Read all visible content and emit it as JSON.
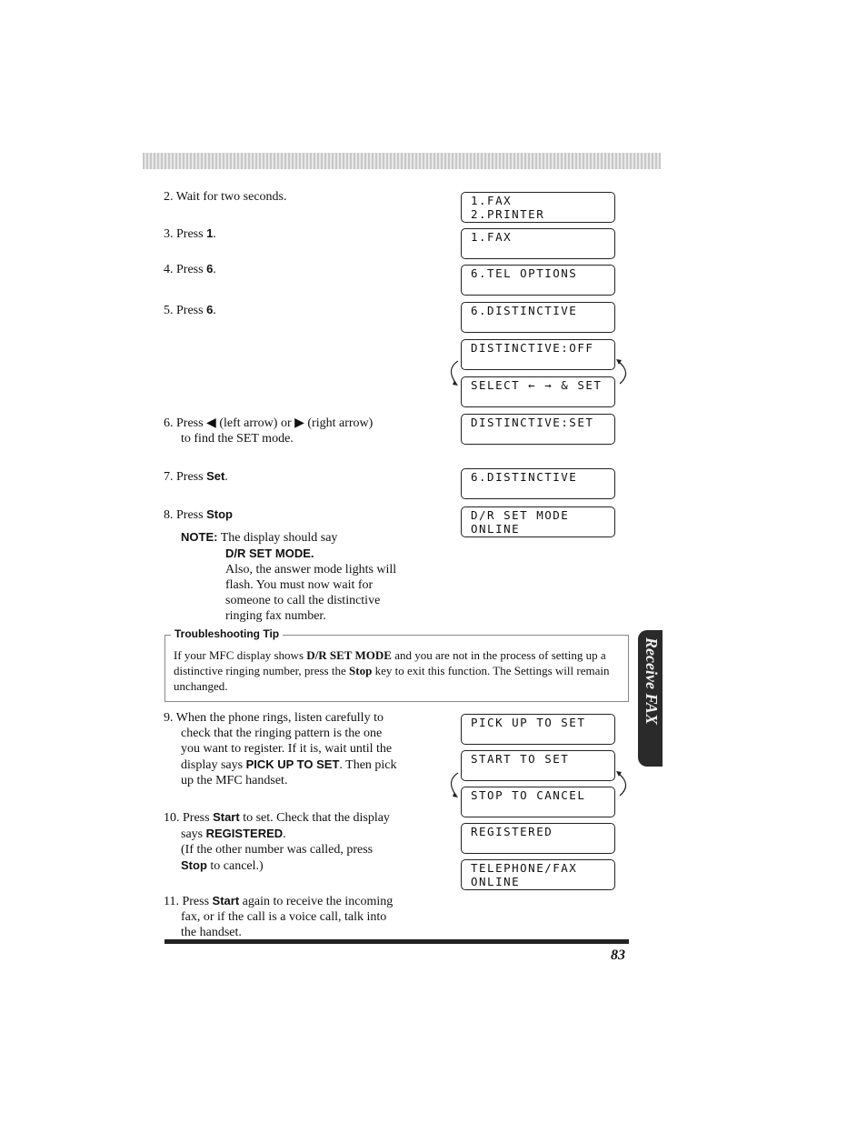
{
  "steps": [
    {
      "num": "2.",
      "text": "Wait for two seconds."
    },
    {
      "num": "3.",
      "pre": "Press ",
      "key": "1",
      "post": "."
    },
    {
      "num": "4.",
      "pre": "Press ",
      "key": "6",
      "post": "."
    },
    {
      "num": "5.",
      "pre": "Press ",
      "key": "6",
      "post": "."
    },
    {
      "num": "6.",
      "line1": "Press ◀ (left arrow) or ▶ (right arrow)",
      "line2": "to find the SET mode."
    },
    {
      "num": "7.",
      "pre": "Press ",
      "key": "Set",
      "post": "."
    },
    {
      "num": "8.",
      "pre": "Press ",
      "key": "Stop",
      "post": ""
    },
    {
      "num": "9.",
      "l1": "When the phone rings, listen carefully to",
      "l2": "check that the ringing pattern is the one",
      "l3": "you want to register. If it is, wait until the",
      "l4a": "display says ",
      "l4b": "PICK UP TO SET",
      "l4c": ". Then pick",
      "l5": "up the MFC handset."
    },
    {
      "num": "10.",
      "pre": "Press ",
      "key": "Start",
      "post": " to set. Check that the display",
      "l2a": "says ",
      "l2b": "REGISTERED",
      "l2c": ".",
      "l3": "(If the other number was called, press",
      "l4a": "Stop",
      "l4b": " to cancel.)"
    },
    {
      "num": "11.",
      "pre": "Press ",
      "key": "Start",
      "post": " again to receive the incoming",
      "l2": "fax, or if the call is a voice call, talk into",
      "l3": "the handset."
    }
  ],
  "note": {
    "label": "NOTE:",
    "l1": "The display should say",
    "l2": "D/R SET MODE.",
    "l3": "Also, the answer mode lights will",
    "l4": "flash. You must now wait for",
    "l5": "someone to call the distinctive",
    "l6": "ringing fax number."
  },
  "tip": {
    "title": "Troubleshooting Tip",
    "a": "If your MFC display shows ",
    "b": "D/R SET MODE",
    "c": " and you are not in the process of setting up a distinctive ringing number, press the ",
    "d": "Stop",
    "e": " key to exit this function. The Settings will remain unchanged."
  },
  "lcd": [
    "1.FAX\n2.PRINTER",
    "1.FAX",
    "6.TEL OPTIONS",
    "6.DISTINCTIVE",
    "DISTINCTIVE:OFF",
    "SELECT ← → & SET",
    "DISTINCTIVE:SET",
    "6.DISTINCTIVE",
    "D/R SET MODE\nONLINE",
    "PICK UP TO SET",
    "START TO SET",
    "STOP TO CANCEL",
    "REGISTERED",
    "TELEPHONE/FAX\nONLINE"
  ],
  "side_tab": "Receive FAX",
  "page_number": "83"
}
